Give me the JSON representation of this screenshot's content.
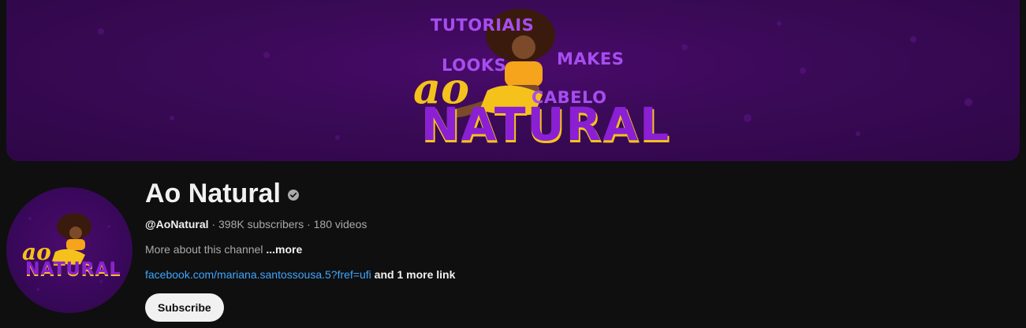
{
  "banner": {
    "word_tutoriais": "TUTORIAIS",
    "word_looks": "LOOKS",
    "word_makes": "MAKES",
    "word_cabelo": "CABELO",
    "logo_ao": "ao",
    "logo_natural": "NATURAL"
  },
  "avatar": {
    "logo_ao": "ao",
    "logo_natural": "NATURAL"
  },
  "channel": {
    "name": "Ao Natural",
    "handle": "@AoNatural",
    "separator": " · ",
    "subscribers": "398K subscribers",
    "videos": "180 videos",
    "description": "More about this channel",
    "more_label": "...more",
    "link": "facebook.com/mariana.santossousa.5?fref=ufi",
    "more_links": "and 1 more link",
    "subscribe_label": "Subscribe"
  },
  "colors": {
    "background": "#0f0f0f",
    "banner_purple": "#3b0a58",
    "logo_yellow": "#f5c21b",
    "logo_purple": "#8a1fd4",
    "link_blue": "#3ea6ff"
  },
  "icons": {
    "verified": "verified-check-icon"
  }
}
